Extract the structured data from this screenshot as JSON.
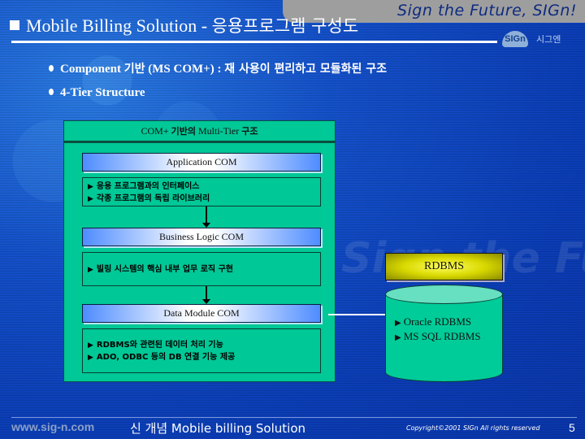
{
  "header": {
    "tagline": "Sign the Future, SIGn!",
    "title_en": "Mobile Billing Solution - ",
    "title_kr": "응용프로그램 구성도",
    "logo_badge": "SIGn",
    "logo_text": "시그엔"
  },
  "bullets": [
    {
      "en_1": "Component ",
      "kr_1": "기반",
      "en_2": " (MS COM+) : ",
      "kr_2": "재 사용이 편리하고 모듈화된 구조"
    },
    {
      "en_1": "4-Tier Structure"
    }
  ],
  "watermark": "Sign the Future, SIGn !",
  "diagram": {
    "panel_title_en1": "COM+ ",
    "panel_title_kr1": "기반의",
    "panel_title_en2": " Multi-Tier ",
    "panel_title_kr2": "구조",
    "tiers": [
      {
        "label": "Application COM",
        "items": [
          "응용 프로그램과의 인터페이스",
          "각종 프로그램의 독립 라이브러리"
        ]
      },
      {
        "label": "Business Logic COM",
        "items": [
          "빌링 시스템의 핵심 내부 업무 로직 구현"
        ]
      },
      {
        "label": "Data Module COM",
        "items": [
          "RDBMS와 관련된 데이터 처리 기능",
          "ADO, ODBC 등의 DB 연결 기능 제공"
        ]
      }
    ],
    "rdbms": {
      "label": "RDBMS",
      "items": [
        "Oracle RDBMS",
        "MS SQL RDBMS"
      ]
    }
  },
  "icons": {
    "bullet_marker": "▶",
    "title_marker": "■"
  },
  "footer": {
    "url": "www.sig-n.com",
    "title": "신 개념 Mobile billing Solution",
    "copyright": "Copyright©2001 SIGn All rights reserved",
    "page_number": "5"
  }
}
